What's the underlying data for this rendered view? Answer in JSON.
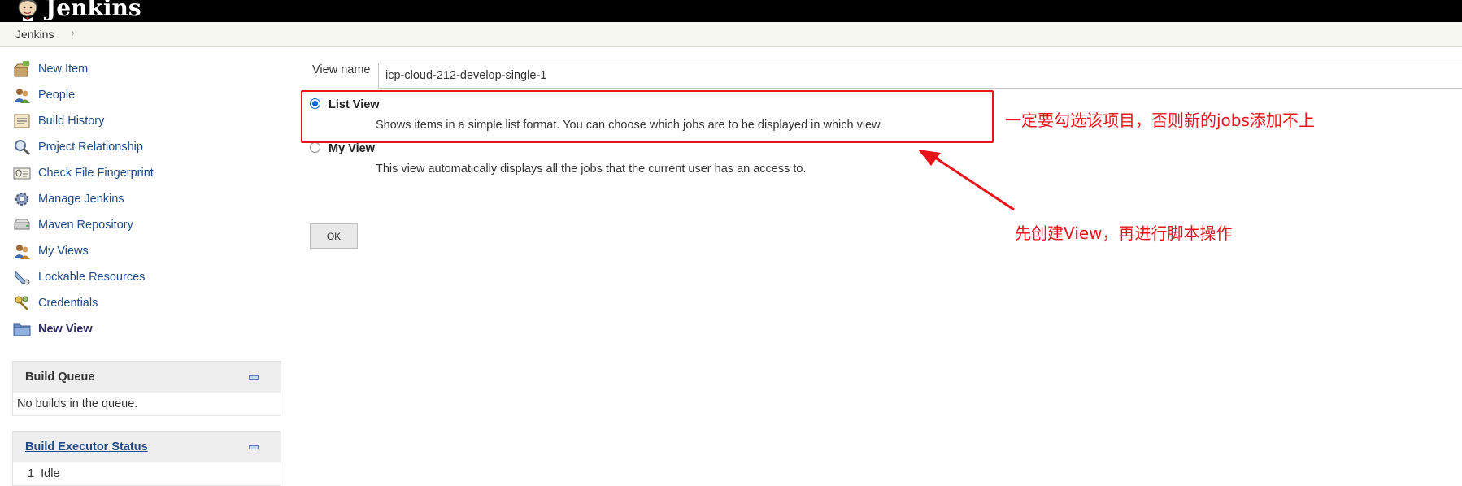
{
  "header": {
    "app_name": "Jenkins",
    "logo_icon": "jenkins-butler-icon"
  },
  "breadcrumb": {
    "items": [
      "Jenkins"
    ]
  },
  "sidebar": {
    "items": [
      {
        "label": "New Item",
        "icon": "new-item-icon"
      },
      {
        "label": "People",
        "icon": "people-icon"
      },
      {
        "label": "Build History",
        "icon": "build-history-icon"
      },
      {
        "label": "Project Relationship",
        "icon": "magnifier-icon"
      },
      {
        "label": "Check File Fingerprint",
        "icon": "fingerprint-icon"
      },
      {
        "label": "Manage Jenkins",
        "icon": "gear-icon"
      },
      {
        "label": "Maven Repository",
        "icon": "hard-drive-icon"
      },
      {
        "label": "My Views",
        "icon": "my-views-icon"
      },
      {
        "label": "Lockable Resources",
        "icon": "lockable-resources-icon"
      },
      {
        "label": "Credentials",
        "icon": "keys-icon"
      },
      {
        "label": "New View",
        "icon": "folder-icon",
        "active": true
      }
    ]
  },
  "build_queue": {
    "title": "Build Queue",
    "empty_text": "No builds in the queue."
  },
  "executor_status": {
    "title": "Build Executor Status",
    "executors": [
      {
        "number": "1",
        "state": "Idle"
      }
    ]
  },
  "form": {
    "view_name_label": "View name",
    "view_name_value": "icp-cloud-212-develop-single-1",
    "options": [
      {
        "title": "List View",
        "description": "Shows items in a simple list format. You can choose which jobs are to be displayed in which view.",
        "selected": true
      },
      {
        "title": "My View",
        "description": "This view automatically displays all the jobs that the current user has an access to.",
        "selected": false
      }
    ],
    "ok_label": "OK"
  },
  "annotations": {
    "note_top": "一定要勾选该项目，否则新的jobs添加不上",
    "note_bottom": "先创建View，再进行脚本操作",
    "color": "#e8141c"
  }
}
